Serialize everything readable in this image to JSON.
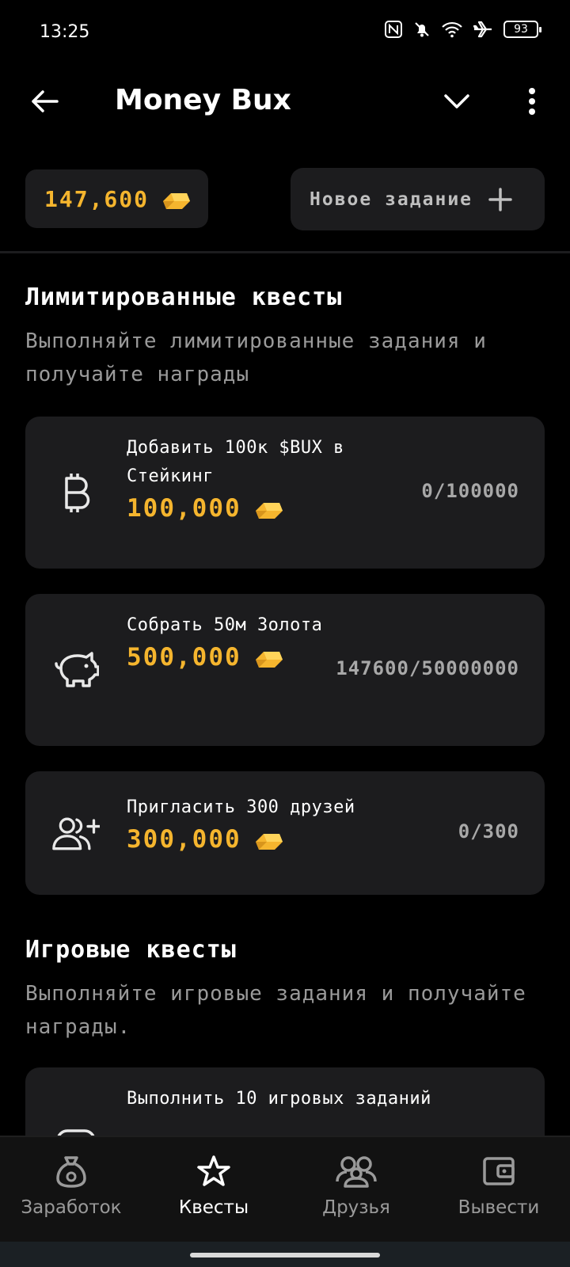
{
  "status_bar": {
    "time": "13:25",
    "battery": "93",
    "icons": [
      "nfc-icon",
      "bell-muted-icon",
      "wifi-icon",
      "airplane-icon",
      "battery-icon"
    ]
  },
  "app_bar": {
    "title": "Money Bux",
    "icons": [
      "back-arrow-icon",
      "chevron-down-icon",
      "more-vert-icon"
    ]
  },
  "balance": {
    "value": "147,600",
    "icon": "gold-bar-icon"
  },
  "new_task": {
    "label": "Новое задание",
    "icon": "plus-icon"
  },
  "limited": {
    "title": "Лимитированные квесты",
    "subtitle": "Выполняйте лимитированные задания и получайте награды",
    "cards": [
      {
        "icon": "bitcoin-icon",
        "title": "Добавить 100к $BUX в Стейкинг",
        "reward": "100,000",
        "progress": "0/100000"
      },
      {
        "icon": "piggy-bank-icon",
        "title": "Собрать 50м Золота",
        "reward": "500,000",
        "progress": "147600/50000000"
      },
      {
        "icon": "add-friend-icon",
        "title": "Пригласить 300 друзей",
        "reward": "300,000",
        "progress": "0/300"
      }
    ]
  },
  "game": {
    "title": "Игровые квесты",
    "subtitle": "Выполняйте игровые задания и получайте награды.",
    "cards": [
      {
        "icon": "gamepad-icon",
        "title": "Выполнить 10 игровых заданий"
      }
    ]
  },
  "bottom_nav": {
    "active_color": "#ffffff",
    "inactive_color": "#9a9a9a",
    "items": [
      {
        "label": "Заработок",
        "icon": "money-bag-icon",
        "active": false
      },
      {
        "label": "Квесты",
        "icon": "star-icon",
        "active": true
      },
      {
        "label": "Друзья",
        "icon": "friends-icon",
        "active": false
      },
      {
        "label": "Вывести",
        "icon": "wallet-icon",
        "active": false
      }
    ]
  },
  "colors": {
    "accent_gold": "#f5b52e",
    "card_bg": "#1c1c1e",
    "background": "#000000"
  }
}
